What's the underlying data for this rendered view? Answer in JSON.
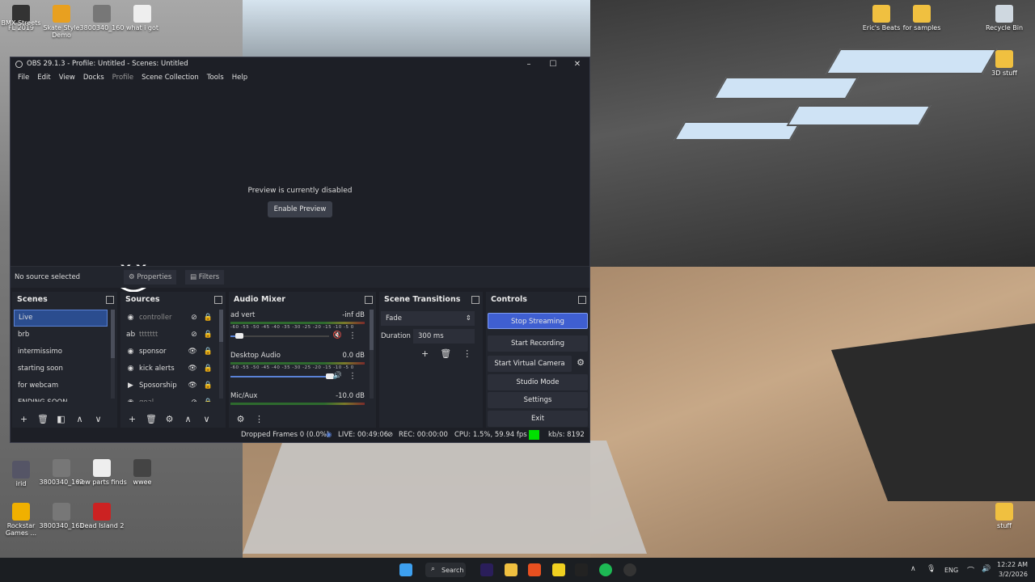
{
  "desktop": {
    "icons_left": [
      {
        "label": "FL 2019"
      },
      {
        "label": "BMX Streets"
      },
      {
        "label": "Skate Style Demo"
      },
      {
        "label": "3800340_160"
      },
      {
        "label": "what i got"
      },
      {
        "label": "irid"
      },
      {
        "label": "3800340_162"
      },
      {
        "label": "new parts finds"
      },
      {
        "label": "wwee"
      },
      {
        "label": "Rockstar Games ..."
      },
      {
        "label": "3800340_161"
      },
      {
        "label": "Dead Island 2"
      }
    ],
    "icons_right": [
      {
        "label": "Eric's Beats"
      },
      {
        "label": "for samples"
      },
      {
        "label": "Recycle Bin"
      },
      {
        "label": "3D stuff"
      },
      {
        "label": "stuff"
      }
    ]
  },
  "obs": {
    "title": "OBS 29.1.3 - Profile: Untitled - Scenes: Untitled",
    "menu": [
      "File",
      "Edit",
      "View",
      "Docks",
      "Profile",
      "Scene Collection",
      "Tools",
      "Help"
    ],
    "preview": {
      "disabled_text": "Preview is currently disabled",
      "enable_button": "Enable Preview",
      "mascot_text": "X X"
    },
    "source_bar": {
      "no_source": "No source selected",
      "properties": "Properties",
      "filters": "Filters"
    },
    "scenes": {
      "title": "Scenes",
      "items": [
        "Live",
        "brb",
        "intermissimo",
        "starting soon",
        "for webcam",
        "ENDING SOON"
      ]
    },
    "sources": {
      "title": "Sources",
      "items": [
        {
          "name": "controller",
          "icon": "globe-icon"
        },
        {
          "name": "ttttttt",
          "icon": "text-icon"
        },
        {
          "name": "sponsor",
          "icon": "globe-icon"
        },
        {
          "name": "kick alerts",
          "icon": "globe-icon"
        },
        {
          "name": "Sposorship",
          "icon": "play-icon"
        },
        {
          "name": "goal",
          "icon": "globe-icon"
        }
      ]
    },
    "mixer": {
      "title": "Audio Mixer",
      "ticks": "-60 -55 -50 -45 -40 -35 -30 -25 -20 -15 -10 -5 0",
      "channels": [
        {
          "name": "ad vert",
          "level": "-inf dB",
          "fader": 0.05,
          "muted": true
        },
        {
          "name": "Desktop Audio",
          "level": "0.0 dB",
          "fader": 1.0,
          "muted": false
        },
        {
          "name": "Mic/Aux",
          "level": "-10.0 dB",
          "fader": 0.7,
          "muted": false
        }
      ]
    },
    "transitions": {
      "title": "Scene Transitions",
      "selected": "Fade",
      "duration_label": "Duration",
      "duration_value": "300 ms"
    },
    "controls": {
      "title": "Controls",
      "stop_streaming": "Stop Streaming",
      "start_recording": "Start Recording",
      "start_virtual_camera": "Start Virtual Camera",
      "studio_mode": "Studio Mode",
      "settings": "Settings",
      "exit": "Exit"
    },
    "status": {
      "dropped": "Dropped Frames 0 (0.0%)",
      "live": "LIVE: 00:49:06",
      "rec": "REC: 00:00:00",
      "cpu": "CPU: 1.5%, 59.94 fps",
      "kbs": "kb/s: 8192",
      "live_color": "#00e000"
    }
  },
  "taskbar": {
    "search": "Search",
    "lang": "ENG",
    "time": "12:22 AM",
    "date": "3/2/2026"
  }
}
